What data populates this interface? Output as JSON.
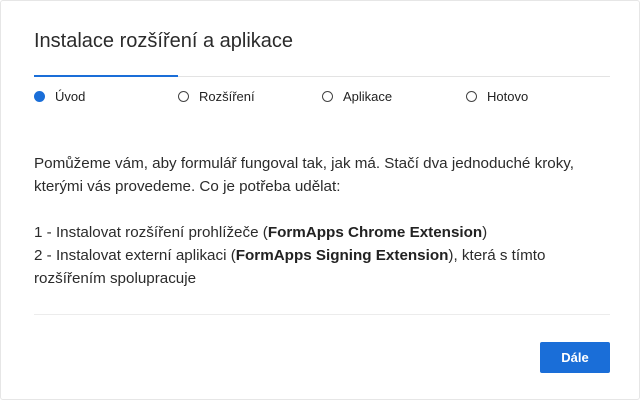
{
  "dialog": {
    "title": "Instalace rozšíření a aplikace"
  },
  "steps": {
    "progress_fraction": 0.25,
    "items": [
      {
        "label": "Úvod",
        "active": true
      },
      {
        "label": "Rozšíření",
        "active": false
      },
      {
        "label": "Aplikace",
        "active": false
      },
      {
        "label": "Hotovo",
        "active": false
      }
    ]
  },
  "content": {
    "intro": "Pomůžeme vám, aby formulář fungoval tak, jak má. Stačí dva jednoduché kroky, kterými vás provedeme. Co je potřeba udělat:",
    "step1": {
      "prefix": "1 - Instalovat rozšíření prohlížeče (",
      "bold": "FormApps Chrome Extension",
      "suffix": ")"
    },
    "step2": {
      "prefix": "2 - Instalovat externí aplikaci (",
      "bold": "FormApps Signing Extension",
      "suffix": "), která s tímto rozšířením spolupracuje"
    }
  },
  "footer": {
    "next_label": "Dále"
  },
  "colors": {
    "accent": "#1a6ed8",
    "track": "#e3e3e3"
  }
}
